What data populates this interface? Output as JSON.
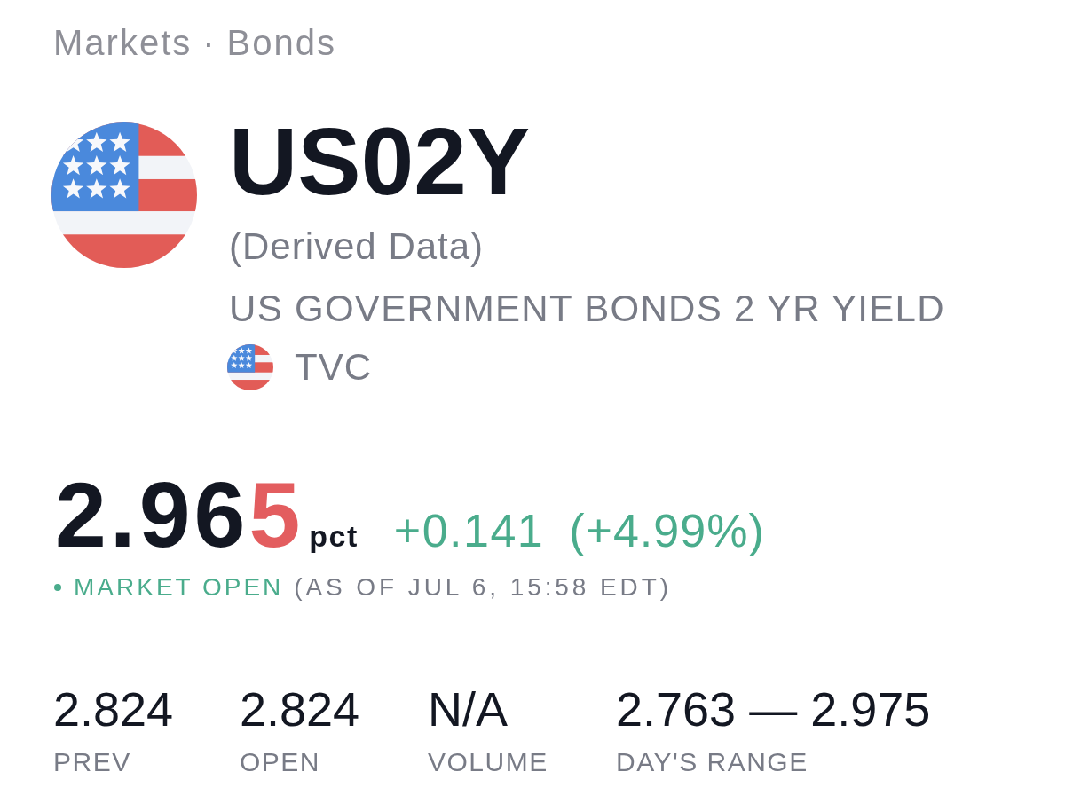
{
  "breadcrumb": {
    "items": [
      "Markets",
      "Bonds"
    ],
    "separator": "·"
  },
  "symbol": {
    "ticker": "US02Y",
    "note": "(Derived Data)",
    "description": "US GOVERNMENT BONDS 2 YR YIELD",
    "exchange": "TVC"
  },
  "quote": {
    "price": "2.96",
    "last_digit": "5",
    "last_tick_down": true,
    "unit": "pct",
    "change": "+0.141",
    "change_percent": "(+4.99%)",
    "rising": true
  },
  "market_status": {
    "label": "MARKET OPEN",
    "open": true,
    "as_of": "(AS OF JUL 6, 15:58 EDT)"
  },
  "stats": [
    {
      "value": "2.824",
      "label": "PREV"
    },
    {
      "value": "2.824",
      "label": "OPEN"
    },
    {
      "value": "N/A",
      "label": "VOLUME"
    },
    {
      "value": "2.763 — 2.975",
      "label": "DAY'S RANGE"
    }
  ]
}
